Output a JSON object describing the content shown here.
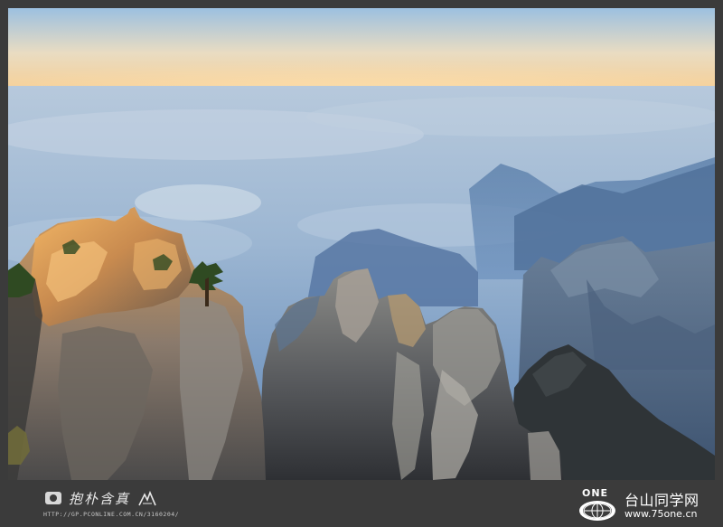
{
  "photo": {
    "subject": "sunlit granite peaks above a sea of clouds",
    "colors": {
      "sky_top": "#8ab0d6",
      "sky_horizon": "#f3cf9a",
      "cloud": "#a9c2dc",
      "haze": "#5f88b8",
      "rock_lit": "#e0a860",
      "rock_shadow": "#3a3e44"
    }
  },
  "footer": {
    "author_signature": "抱朴含真",
    "author_url": "HTTP://GP.PCONLINE.COM.CN/3160204/",
    "brand_logo": "ONE",
    "brand_name": "台山同学网",
    "brand_url": "www.75one.cn"
  },
  "icons": [
    "camera-icon",
    "signature-mark-icon",
    "globe-logo-icon"
  ]
}
